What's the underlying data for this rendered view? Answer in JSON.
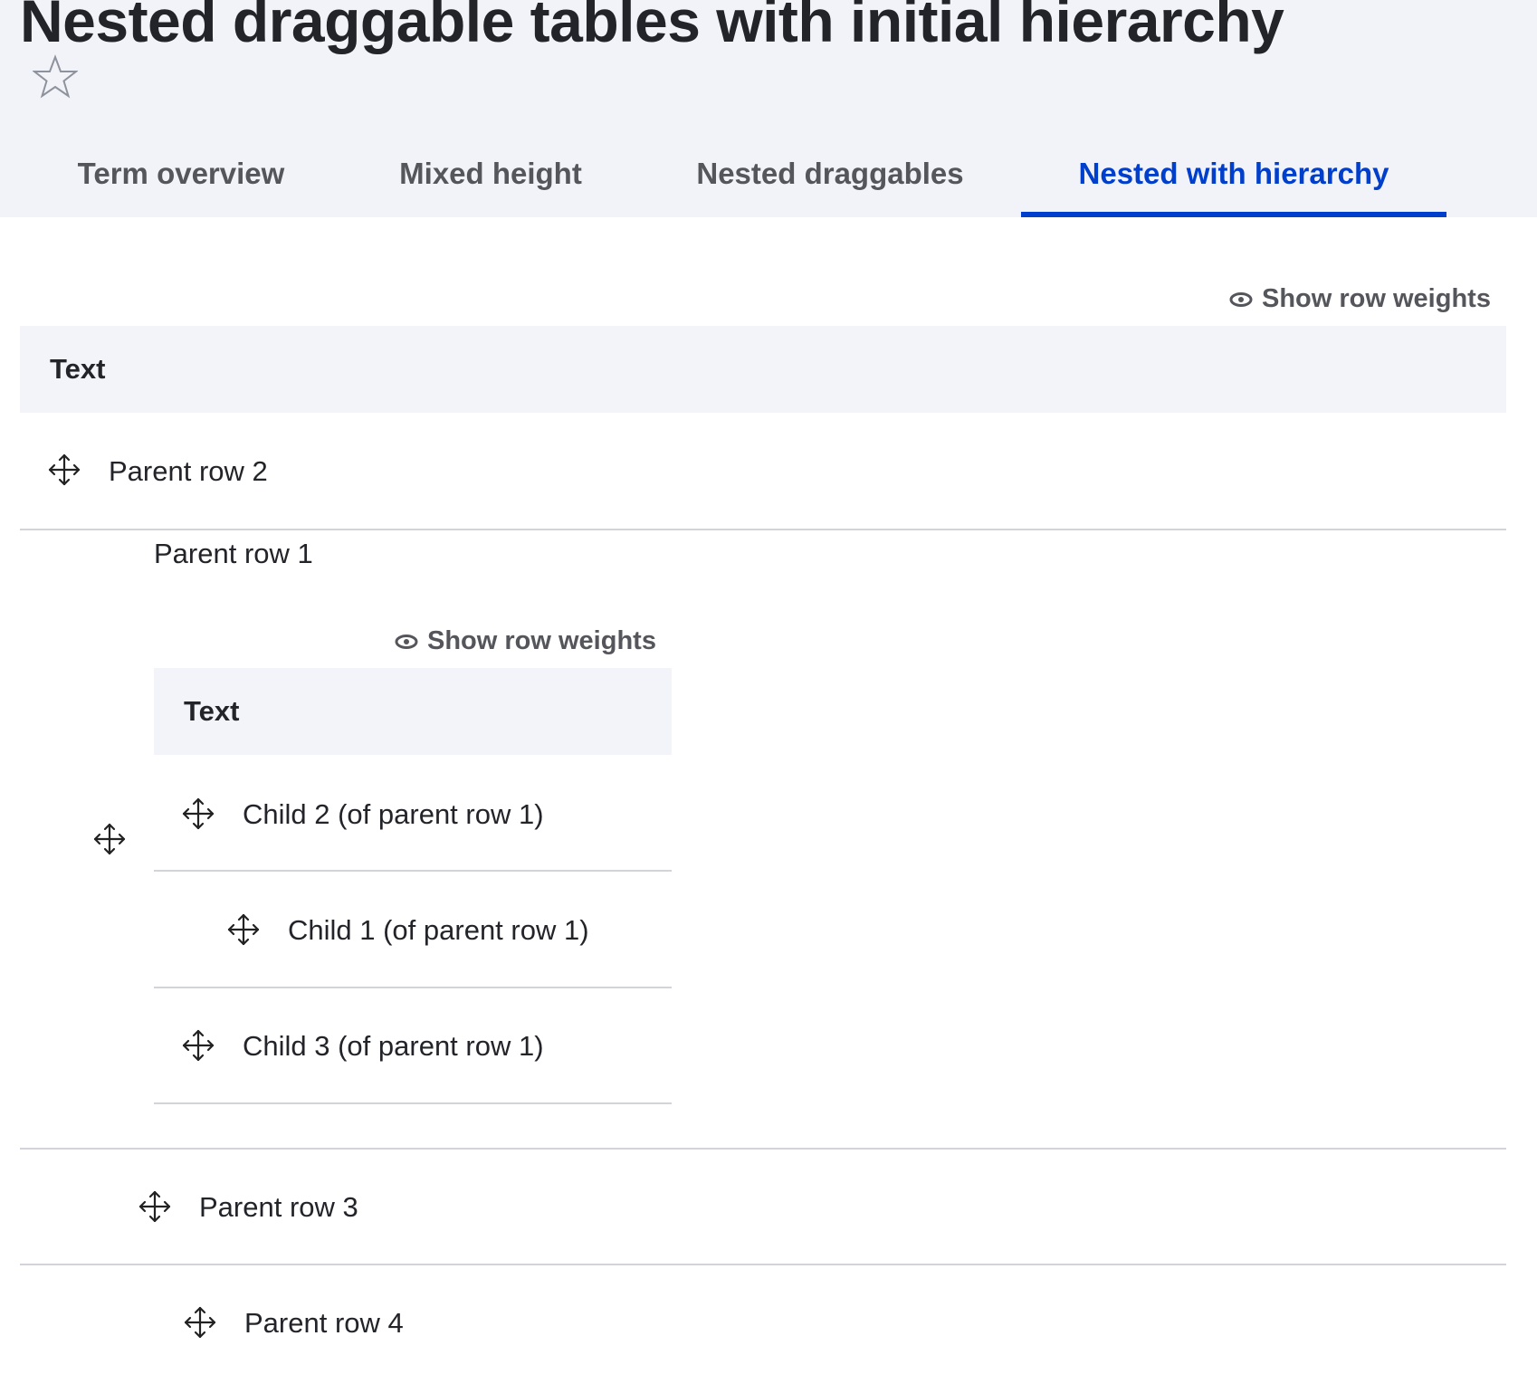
{
  "page": {
    "title": "Nested draggable tables with initial hierarchy",
    "favorite_icon": "star-icon"
  },
  "tabs": [
    {
      "label": "Term overview",
      "active": false
    },
    {
      "label": "Mixed height",
      "active": false
    },
    {
      "label": "Nested draggables",
      "active": false
    },
    {
      "label": "Nested with hierarchy",
      "active": true
    }
  ],
  "outer_table": {
    "show_weights_label": "Show row weights",
    "header": "Text",
    "rows": [
      {
        "label": "Parent row 2",
        "depth": 0
      },
      {
        "label": "Parent row 1",
        "depth": 1
      },
      {
        "label": "Parent row 3",
        "depth": 1
      },
      {
        "label": "Parent row 4",
        "depth": 2
      }
    ]
  },
  "inner_table": {
    "show_weights_label": "Show row weights",
    "header": "Text",
    "rows": [
      {
        "label": "Child 2 (of parent row 1)",
        "depth": 0
      },
      {
        "label": "Child 1 (of parent row 1)",
        "depth": 1
      },
      {
        "label": "Child 3 (of parent row 1)",
        "depth": 0
      }
    ]
  },
  "colors": {
    "accent": "#003ecc",
    "header_bg": "#f2f3f8",
    "text": "#232429",
    "muted": "#55565b",
    "divider": "#d3d4d9"
  }
}
